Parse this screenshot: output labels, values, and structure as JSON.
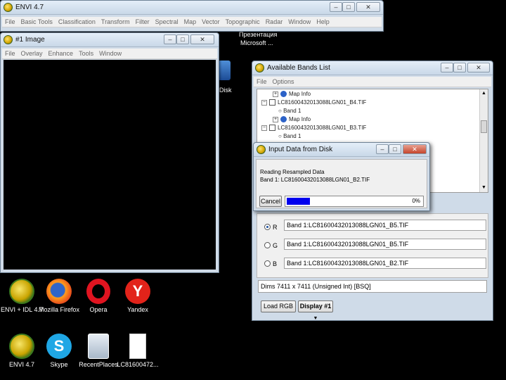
{
  "desktop": {
    "partial_text": [
      "Презентация",
      "Microsoft ..."
    ],
    "icons": [
      {
        "label": "ENVI + IDL 4.7",
        "icon": "envi-globe-icon"
      },
      {
        "label": "Mozilla Firefox",
        "icon": "firefox-icon"
      },
      {
        "label": "Opera",
        "icon": "opera-icon"
      },
      {
        "label": "Yandex",
        "icon": "yandex-icon"
      },
      {
        "label": "ENVI 4.7",
        "icon": "envi-globe-icon"
      },
      {
        "label": "Skype",
        "icon": "skype-icon"
      },
      {
        "label": "RecentPlaces",
        "icon": "recent-places-icon"
      },
      {
        "label": "LC81600472...",
        "icon": "file-icon"
      }
    ],
    "partial_icon_label": "Disk"
  },
  "envi_main": {
    "title": "ENVI 4.7",
    "menu": [
      "File",
      "Basic Tools",
      "Classification",
      "Transform",
      "Filter",
      "Spectral",
      "Map",
      "Vector",
      "Topographic",
      "Radar",
      "Window",
      "Help"
    ]
  },
  "image_window": {
    "title": "#1 Image",
    "menu": [
      "File",
      "Overlay",
      "Enhance",
      "Tools",
      "Window"
    ]
  },
  "bands_list": {
    "title": "Available Bands List",
    "menu": [
      "File",
      "Options"
    ],
    "tree": [
      {
        "label": "Map Info",
        "type": "map"
      },
      {
        "label": "LC81600432013088LGN01_B4.TIF",
        "type": "file"
      },
      {
        "label": "Band 1",
        "type": "band"
      },
      {
        "label": "Map Info",
        "type": "map"
      },
      {
        "label": "LC81600432013088LGN01_B3.TIF",
        "type": "file"
      },
      {
        "label": "Band 1",
        "type": "band"
      }
    ],
    "rgb": [
      {
        "channel": "R",
        "value": "Band 1:LC81600432013088LGN01_B5.TIF",
        "selected": true
      },
      {
        "channel": "G",
        "value": "Band 1:LC81600432013088LGN01_B5.TIF",
        "selected": false
      },
      {
        "channel": "B",
        "value": "Band 1:LC81600432013088LGN01_B2.TIF",
        "selected": false
      }
    ],
    "dims": "Dims 7411 x 7411 (Unsigned Int) [BSQ]",
    "load_button": "Load RGB",
    "display_button": "Display #1"
  },
  "input_dialog": {
    "title": "Input Data from Disk",
    "line1": "Reading Resampled Data",
    "line2": "Band 1: LC81600432013088LGN01_B2.TIF",
    "cancel_label": "Cancel",
    "progress_fraction": 0.17,
    "percent_text": "0%",
    "progress_color": "#0000ee"
  },
  "colors": {
    "desktop_bg": "#000000",
    "window_frame": "#cfdbe8",
    "panel": "#f0f0f0"
  }
}
